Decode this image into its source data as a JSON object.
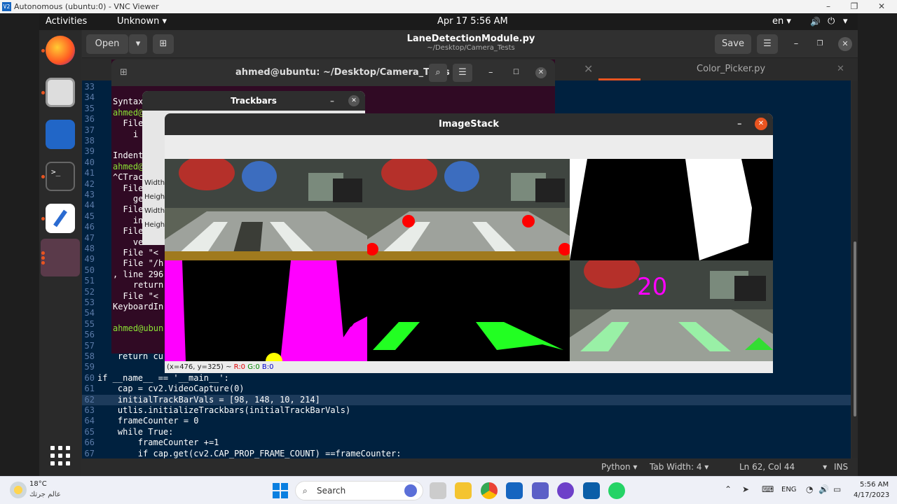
{
  "vnc": {
    "title": "Autonomous (ubuntu:0) - VNC Viewer",
    "icon": "V2",
    "minimize": "–",
    "maximize": "❐",
    "close": "✕"
  },
  "topbar": {
    "activities": "Activities",
    "app": "Unknown",
    "datetime": "Apr 17  5:56 AM",
    "lang": "en",
    "caret": "▾"
  },
  "gedit": {
    "open": "Open",
    "filename": "LaneDetectionModule.py",
    "path": "~/Desktop/Camera_Tests",
    "save": "Save",
    "tab2": "Color_Picker.py"
  },
  "status": {
    "lang": "Python",
    "tabwidth": "Tab Width: 4",
    "pos": "Ln 62, Col 44",
    "mode": "INS"
  },
  "terminal": {
    "title": "ahmed@ubuntu: ~/Desktop/Camera_Tests",
    "lines": [
      "",
      "Syntax",
      "ahmed@",
      "  File",
      "    i",
      "",
      "Indent",
      "ahmed@",
      "^CTrac",
      "  File",
      "    ge",
      "  File",
      "    in",
      "  File",
      "    ver =",
      "  File \"<",
      "  File \"/h",
      ", line 296",
      "    return",
      "  File \"<",
      "KeyboardIn",
      "",
      "ahmed@ubun"
    ]
  },
  "trackbars": {
    "title": "Trackbars",
    "labels": [
      "Width",
      "Heigh",
      "Width",
      "Heigh"
    ]
  },
  "imagestack": {
    "title": "ImageStack",
    "coord_prefix": "(x=476, y=325) ~ ",
    "r": "R:0",
    "g": "G:0",
    "b": "B:0",
    "curve_value": "20"
  },
  "code": [
    {
      "n": "33",
      "t": ""
    },
    {
      "n": "34",
      "t": ""
    },
    {
      "n": "35",
      "t": ""
    },
    {
      "n": "36",
      "t": ""
    },
    {
      "n": "37",
      "t": ""
    },
    {
      "n": "38",
      "t": ""
    },
    {
      "n": "39",
      "t": ""
    },
    {
      "n": "40",
      "t": ""
    },
    {
      "n": "41",
      "t": ""
    },
    {
      "n": "42",
      "t": ""
    },
    {
      "n": "43",
      "t": ""
    },
    {
      "n": "44",
      "t": ""
    },
    {
      "n": "45",
      "t": ""
    },
    {
      "n": "46",
      "t": ""
    },
    {
      "n": "47",
      "t": ""
    },
    {
      "n": "48",
      "t": ""
    },
    {
      "n": "49",
      "t": ""
    },
    {
      "n": "50",
      "t": ""
    },
    {
      "n": "51",
      "t": ""
    },
    {
      "n": "52",
      "t": ""
    },
    {
      "n": "53",
      "t": ""
    },
    {
      "n": "54",
      "t": ""
    },
    {
      "n": "55",
      "t": ""
    },
    {
      "n": "56",
      "t": ""
    },
    {
      "n": "57",
      "t": ""
    },
    {
      "n": "58",
      "t": "    return cu"
    },
    {
      "n": "59",
      "t": ""
    },
    {
      "n": "60",
      "t": "if __name__ == '__main__':"
    },
    {
      "n": "61",
      "t": "    cap = cv2.VideoCapture(0)"
    },
    {
      "n": "62",
      "t": "    initialTrackBarVals = [98, 148, 10, 214]"
    },
    {
      "n": "63",
      "t": "    utlis.initializeTrackbars(initialTrackBarVals)"
    },
    {
      "n": "64",
      "t": "    frameCounter = 0"
    },
    {
      "n": "65",
      "t": "    while True:"
    },
    {
      "n": "66",
      "t": "        frameCounter +=1"
    },
    {
      "n": "67",
      "t": "        if cap.get(cv2.CAP_PROP_FRAME_COUNT) ==frameCounter:"
    }
  ],
  "taskbar": {
    "temp": "18°C",
    "weather": "عالم جرتك",
    "search": "Search",
    "lang": "ENG",
    "time": "5:56 AM",
    "date": "4/17/2023"
  },
  "colors": {
    "accent": "#e95420",
    "editor_bg": "#00213f",
    "magenta": "#ff00ff",
    "green": "#22ff22",
    "term_bg": "#300a24"
  }
}
